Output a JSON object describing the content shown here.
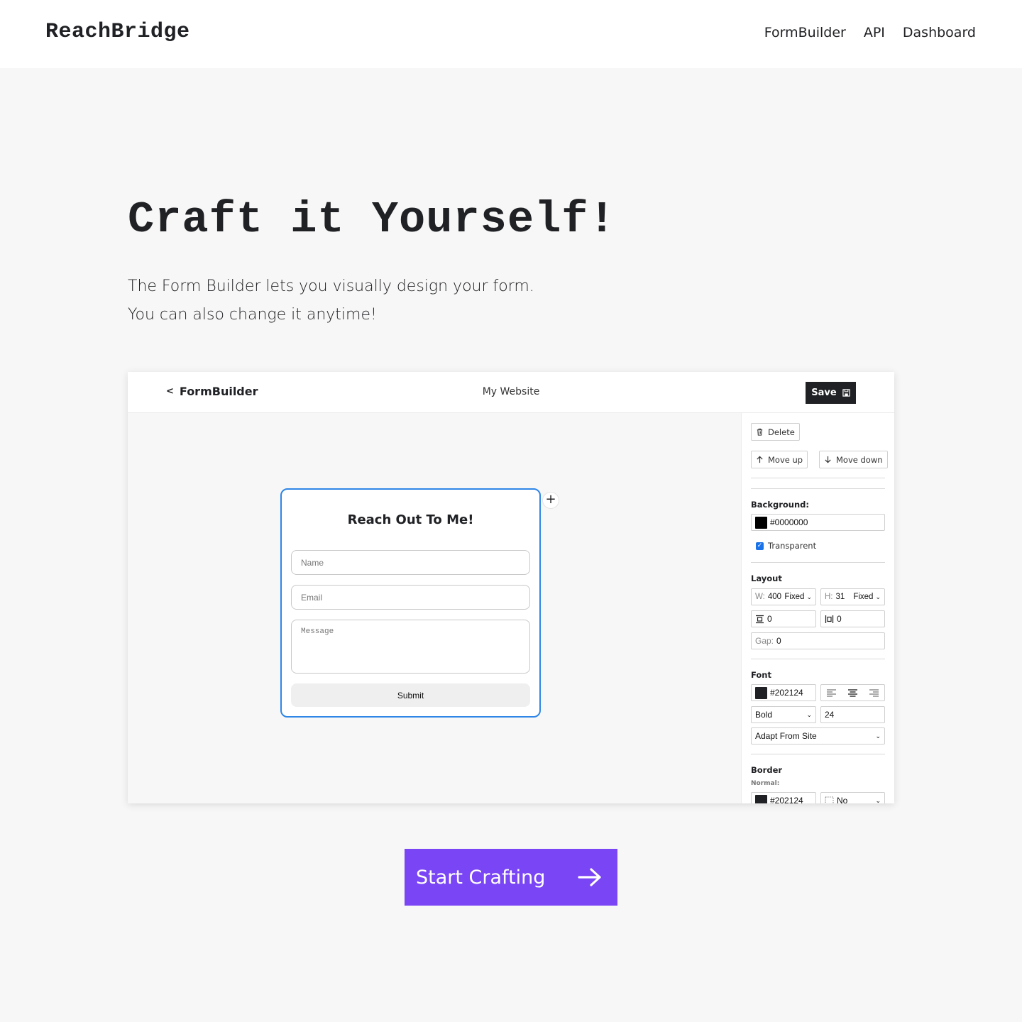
{
  "site": {
    "logo": "ReachBridge",
    "nav": [
      "FormBuilder",
      "API",
      "Dashboard"
    ]
  },
  "hero": {
    "title": "Craft it Yourself!",
    "line1": "The Form Builder lets you visually design your form.",
    "line2": "You can also change it anytime!"
  },
  "app": {
    "back_label": "FormBuilder",
    "back_icon": "chevron-left-icon",
    "site_name": "My Website",
    "save_label": "Save",
    "save_icon": "floppy-disk-icon"
  },
  "form": {
    "title": "Reach Out To Me!",
    "name_placeholder": "Name",
    "email_placeholder": "Email",
    "message_placeholder": "Message",
    "submit_label": "Submit",
    "add_icon": "plus-icon"
  },
  "panel": {
    "delete_label": "Delete",
    "move_up_label": "Move up",
    "move_down_label": "Move down",
    "background_label": "Background:",
    "background_value": "#0000000",
    "transparent_label": "Transparent",
    "transparent_checked": true,
    "layout_label": "Layout",
    "w_prefix": "W:",
    "w_value": "400",
    "w_mode": "Fixed",
    "h_prefix": "H:",
    "h_value": "31",
    "h_mode": "Fixed",
    "padding_v": "0",
    "padding_h": "0",
    "gap_prefix": "Gap:",
    "gap_value": "0",
    "font_label": "Font",
    "font_color": "#202124",
    "font_weight": "Bold",
    "font_size": "24",
    "font_family": "Adapt From Site",
    "border_label": "Border",
    "border_state": "Normal:",
    "border_color": "#202124",
    "border_style": "No"
  },
  "cta": {
    "label": "Start Crafting",
    "icon": "arrow-right-icon"
  },
  "colors": {
    "accent": "#7a45f5",
    "selection": "#2f86e6",
    "dark": "#202124",
    "page_bg": "#f7f7f7"
  }
}
